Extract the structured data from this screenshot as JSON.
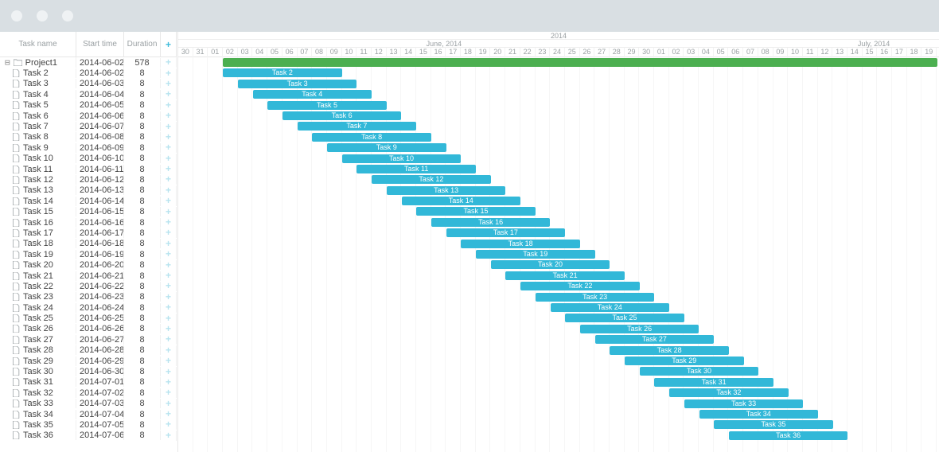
{
  "header": {
    "col_name": "Task name",
    "col_start": "Start time",
    "col_duration": "Duration",
    "year": "2014",
    "months": [
      {
        "label": "June, 2014",
        "dayIndex": 18
      },
      {
        "label": "July, 2014",
        "dayIndex": 47
      }
    ],
    "days": [
      "30",
      "31",
      "01",
      "02",
      "03",
      "04",
      "05",
      "06",
      "07",
      "08",
      "09",
      "10",
      "11",
      "12",
      "13",
      "14",
      "15",
      "16",
      "17",
      "18",
      "19",
      "20",
      "21",
      "22",
      "23",
      "24",
      "25",
      "26",
      "27",
      "28",
      "29",
      "30",
      "01",
      "02",
      "03",
      "04",
      "05",
      "06",
      "07",
      "08",
      "09",
      "10",
      "11",
      "12",
      "13",
      "14",
      "15",
      "16",
      "17",
      "18",
      "19"
    ]
  },
  "timeline": {
    "dayWidth": 18.7,
    "taskSpanDays": 8
  },
  "colors": {
    "project": "#4caf50",
    "task": "#32b8d8"
  },
  "tasks": [
    {
      "name": "Project1",
      "start": "2014-06-02",
      "duration": "578",
      "type": "project",
      "startDay": 3,
      "spanDays": 48
    },
    {
      "name": "Task 2",
      "start": "2014-06-02",
      "duration": "8",
      "type": "task",
      "startDay": 3
    },
    {
      "name": "Task 3",
      "start": "2014-06-03",
      "duration": "8",
      "type": "task",
      "startDay": 4
    },
    {
      "name": "Task 4",
      "start": "2014-06-04",
      "duration": "8",
      "type": "task",
      "startDay": 5
    },
    {
      "name": "Task 5",
      "start": "2014-06-05",
      "duration": "8",
      "type": "task",
      "startDay": 6
    },
    {
      "name": "Task 6",
      "start": "2014-06-06",
      "duration": "8",
      "type": "task",
      "startDay": 7
    },
    {
      "name": "Task 7",
      "start": "2014-06-07",
      "duration": "8",
      "type": "task",
      "startDay": 8
    },
    {
      "name": "Task 8",
      "start": "2014-06-08",
      "duration": "8",
      "type": "task",
      "startDay": 9
    },
    {
      "name": "Task 9",
      "start": "2014-06-09",
      "duration": "8",
      "type": "task",
      "startDay": 10
    },
    {
      "name": "Task 10",
      "start": "2014-06-10",
      "duration": "8",
      "type": "task",
      "startDay": 11
    },
    {
      "name": "Task 11",
      "start": "2014-06-11",
      "duration": "8",
      "type": "task",
      "startDay": 12
    },
    {
      "name": "Task 12",
      "start": "2014-06-12",
      "duration": "8",
      "type": "task",
      "startDay": 13
    },
    {
      "name": "Task 13",
      "start": "2014-06-13",
      "duration": "8",
      "type": "task",
      "startDay": 14
    },
    {
      "name": "Task 14",
      "start": "2014-06-14",
      "duration": "8",
      "type": "task",
      "startDay": 15
    },
    {
      "name": "Task 15",
      "start": "2014-06-15",
      "duration": "8",
      "type": "task",
      "startDay": 16
    },
    {
      "name": "Task 16",
      "start": "2014-06-16",
      "duration": "8",
      "type": "task",
      "startDay": 17
    },
    {
      "name": "Task 17",
      "start": "2014-06-17",
      "duration": "8",
      "type": "task",
      "startDay": 18
    },
    {
      "name": "Task 18",
      "start": "2014-06-18",
      "duration": "8",
      "type": "task",
      "startDay": 19
    },
    {
      "name": "Task 19",
      "start": "2014-06-19",
      "duration": "8",
      "type": "task",
      "startDay": 20
    },
    {
      "name": "Task 20",
      "start": "2014-06-20",
      "duration": "8",
      "type": "task",
      "startDay": 21
    },
    {
      "name": "Task 21",
      "start": "2014-06-21",
      "duration": "8",
      "type": "task",
      "startDay": 22
    },
    {
      "name": "Task 22",
      "start": "2014-06-22",
      "duration": "8",
      "type": "task",
      "startDay": 23
    },
    {
      "name": "Task 23",
      "start": "2014-06-23",
      "duration": "8",
      "type": "task",
      "startDay": 24
    },
    {
      "name": "Task 24",
      "start": "2014-06-24",
      "duration": "8",
      "type": "task",
      "startDay": 25
    },
    {
      "name": "Task 25",
      "start": "2014-06-25",
      "duration": "8",
      "type": "task",
      "startDay": 26
    },
    {
      "name": "Task 26",
      "start": "2014-06-26",
      "duration": "8",
      "type": "task",
      "startDay": 27
    },
    {
      "name": "Task 27",
      "start": "2014-06-27",
      "duration": "8",
      "type": "task",
      "startDay": 28
    },
    {
      "name": "Task 28",
      "start": "2014-06-28",
      "duration": "8",
      "type": "task",
      "startDay": 29
    },
    {
      "name": "Task 29",
      "start": "2014-06-29",
      "duration": "8",
      "type": "task",
      "startDay": 30
    },
    {
      "name": "Task 30",
      "start": "2014-06-30",
      "duration": "8",
      "type": "task",
      "startDay": 31
    },
    {
      "name": "Task 31",
      "start": "2014-07-01",
      "duration": "8",
      "type": "task",
      "startDay": 32
    },
    {
      "name": "Task 32",
      "start": "2014-07-02",
      "duration": "8",
      "type": "task",
      "startDay": 33
    },
    {
      "name": "Task 33",
      "start": "2014-07-03",
      "duration": "8",
      "type": "task",
      "startDay": 34
    },
    {
      "name": "Task 34",
      "start": "2014-07-04",
      "duration": "8",
      "type": "task",
      "startDay": 35
    },
    {
      "name": "Task 35",
      "start": "2014-07-05",
      "duration": "8",
      "type": "task",
      "startDay": 36
    },
    {
      "name": "Task 36",
      "start": "2014-07-06",
      "duration": "8",
      "type": "task",
      "startDay": 37
    }
  ]
}
